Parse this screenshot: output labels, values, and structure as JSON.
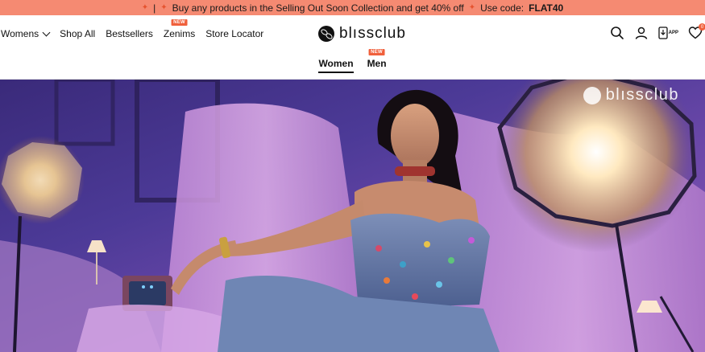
{
  "promo": {
    "text": "Buy any products in the Selling Out Soon Collection and get 40% off",
    "code_label": "Use code:",
    "code": "FLAT40"
  },
  "nav": {
    "items": [
      {
        "label": "Womens",
        "has_dropdown": true
      },
      {
        "label": "Shop All"
      },
      {
        "label": "Bestsellers"
      },
      {
        "label": "Zenims",
        "badge": "NEW"
      },
      {
        "label": "Store Locator"
      }
    ]
  },
  "brand": {
    "name": "blıssclub"
  },
  "header_icons": {
    "search": "search-icon",
    "account": "user-icon",
    "app_label": "APP",
    "wishlist_count": "0"
  },
  "gender_tabs": [
    {
      "label": "Women",
      "active": true
    },
    {
      "label": "Men",
      "badge": "NEW"
    }
  ],
  "hero": {
    "watermark": "blıssclub"
  },
  "colors": {
    "promo_bg": "#f58a72",
    "badge": "#f0603c",
    "hero_purple": "#4c3a97"
  }
}
